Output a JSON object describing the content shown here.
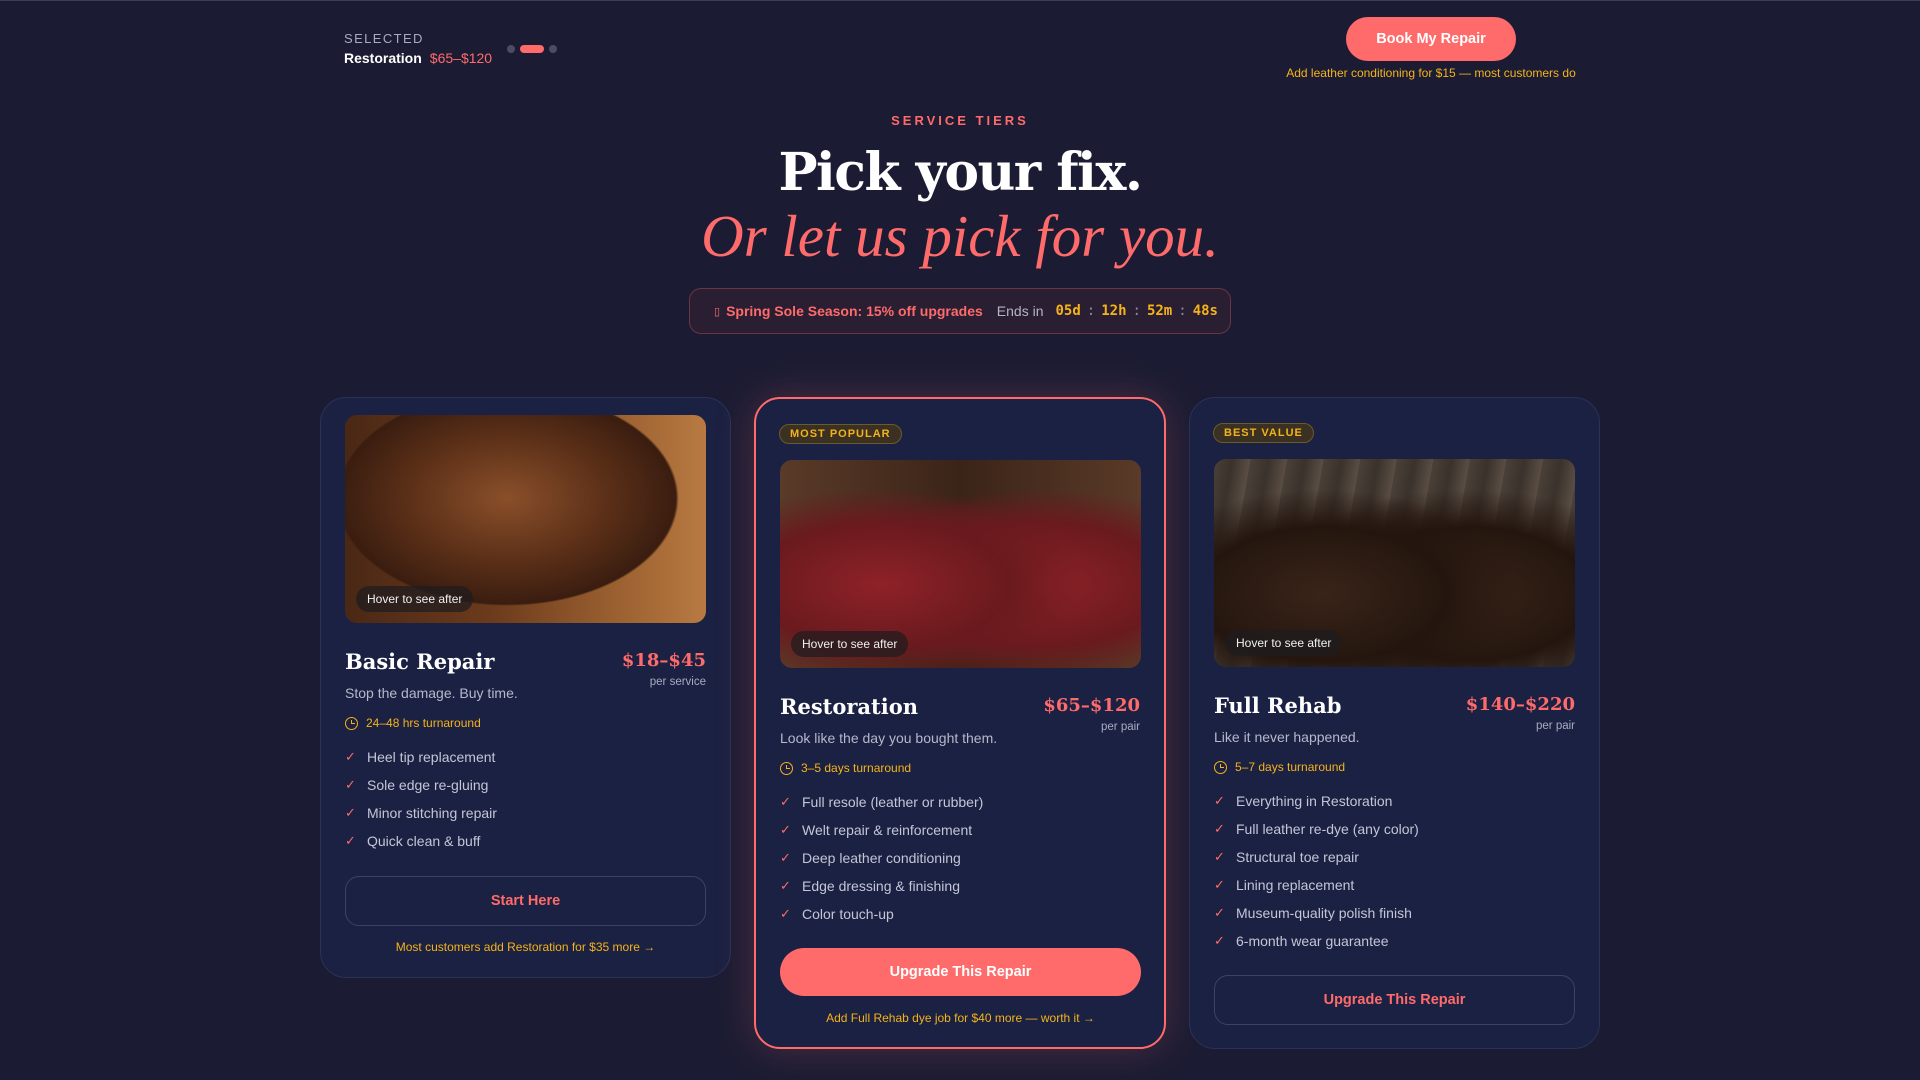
{
  "selection": {
    "label": "SELECTED",
    "name": "Restoration",
    "price": "$65–$120",
    "step_active": 2,
    "step_total": 3
  },
  "cta": {
    "book_label": "Book My Repair",
    "note": "Add leather conditioning for $15 — most customers do"
  },
  "hero": {
    "eyebrow": "SERVICE TIERS",
    "title": "Pick your fix.",
    "subtitle": "Or let us pick for you."
  },
  "promo": {
    "icon": "fire-icon",
    "text": "Spring Sole Season: 15% off upgrades",
    "ends_label": "Ends in",
    "timer": [
      "05d",
      "12h",
      "52m",
      "48s"
    ]
  },
  "tiers": [
    {
      "badge": "",
      "name": "Basic Repair",
      "price": "$18–$45",
      "per": "per service",
      "tagline": "Stop the damage. Buy time.",
      "turnaround": "24–48 hrs turnaround",
      "hover_label": "Hover to see after",
      "features": [
        "Heel tip replacement",
        "Sole edge re-gluing",
        "Minor stitching repair",
        "Quick clean & buff"
      ],
      "button": "Start Here",
      "upsell": "Most customers add Restoration for $35 more →"
    },
    {
      "badge": "MOST POPULAR",
      "name": "Restoration",
      "price": "$65–$120",
      "per": "per pair",
      "tagline": "Look like the day you bought them.",
      "turnaround": "3–5 days turnaround",
      "hover_label": "Hover to see after",
      "features": [
        "Full resole (leather or rubber)",
        "Welt repair & reinforcement",
        "Deep leather conditioning",
        "Edge dressing & finishing",
        "Color touch-up"
      ],
      "button": "Upgrade This Repair",
      "upsell": "Add Full Rehab dye job for $40 more — worth it →"
    },
    {
      "badge": "BEST VALUE",
      "name": "Full Rehab",
      "price": "$140–$220",
      "per": "per pair",
      "tagline": "Like it never happened.",
      "turnaround": "5–7 days turnaround",
      "hover_label": "Hover to see after",
      "features": [
        "Everything in Restoration",
        "Full leather re-dye (any color)",
        "Structural toe repair",
        "Lining replacement",
        "Museum-quality polish finish",
        "6-month wear guarantee"
      ],
      "button": "Upgrade This Repair",
      "upsell": ""
    }
  ],
  "colors": {
    "background": "#1b1c33",
    "card": "#1b2142",
    "accent": "#ff6b6b",
    "gold": "#f5b31a"
  }
}
